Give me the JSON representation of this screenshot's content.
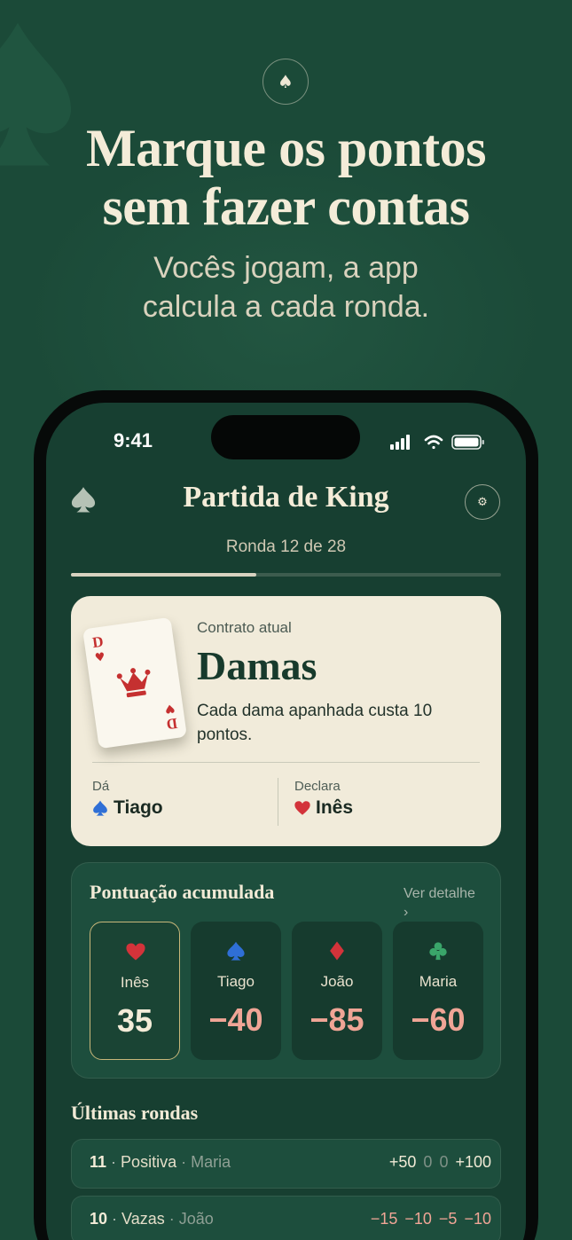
{
  "hero": {
    "badge_icon": "♠",
    "headline_line1": "Marque os pontos",
    "headline_line2": "sem fazer contas",
    "sub_line1": "Vocês jogam, a app",
    "sub_line2": "calcula a cada ronda."
  },
  "status_bar": {
    "time": "9:41",
    "icons": [
      "cellular-signal-icon",
      "wifi-icon",
      "battery-icon"
    ]
  },
  "app": {
    "title": "Partida de King",
    "logo_icon": "spade-icon",
    "settings_icon": "⚙",
    "round_label": "Ronda 12 de 28",
    "round_progress": 0.43
  },
  "contract": {
    "label": "Contrato atual",
    "name": "Damas",
    "description": "Cada dama apanhada custa 10 pontos.",
    "card_rank": "D",
    "card_suit": "♥",
    "dealer_label": "Dá",
    "dealer_name": "Tiago",
    "declarer_label": "Declara",
    "declarer_name": "Inês"
  },
  "scores": {
    "title": "Pontuação acumulada",
    "detail_link": "Ver detalhe ›",
    "players": [
      {
        "name": "Inês",
        "suit": "heart",
        "score": "35",
        "active": true
      },
      {
        "name": "Tiago",
        "suit": "spade",
        "score": "−40",
        "active": false
      },
      {
        "name": "João",
        "suit": "diamond",
        "score": "−85",
        "active": false
      },
      {
        "name": "Maria",
        "suit": "club",
        "score": "−60",
        "active": false
      }
    ]
  },
  "recent": {
    "title": "Últimas rondas",
    "rounds": [
      {
        "num": "11",
        "type": "Positiva",
        "who": "Maria",
        "scores": [
          "+50",
          "0",
          "0",
          "+100"
        ]
      },
      {
        "num": "10",
        "type": "Vazas",
        "who": "João",
        "scores": [
          "−15",
          "−10",
          "−5",
          "−10"
        ]
      }
    ]
  },
  "colors": {
    "background": "#1b4a38",
    "card": "#f1ebda",
    "heart": "#d3333a",
    "spade": "#2f6fd6",
    "diamond": "#d3333a",
    "club": "#3aa56a",
    "active_border": "#c8b77a",
    "negative": "#f0a596"
  }
}
